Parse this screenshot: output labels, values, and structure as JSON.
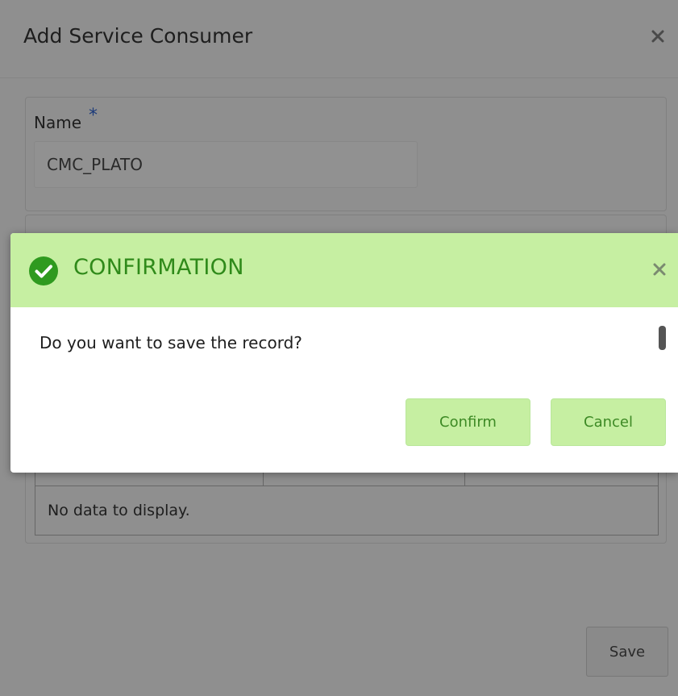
{
  "background_dialog": {
    "title": "Add Service Consumer",
    "close_glyph": "×",
    "name_field": {
      "label": "Name",
      "required_mark": "*",
      "value": "CMC_PLATO"
    },
    "grid": {
      "empty_text": "No data to display."
    },
    "save_label": "Save"
  },
  "confirmation": {
    "title": "CONFIRMATION",
    "icon": "check-circle-icon",
    "close_glyph": "×",
    "message": "Do you want to save the record?",
    "confirm_label": "Confirm",
    "cancel_label": "Cancel",
    "colors": {
      "header_bg": "#c6efa2",
      "accent": "#2f8a1a"
    }
  }
}
